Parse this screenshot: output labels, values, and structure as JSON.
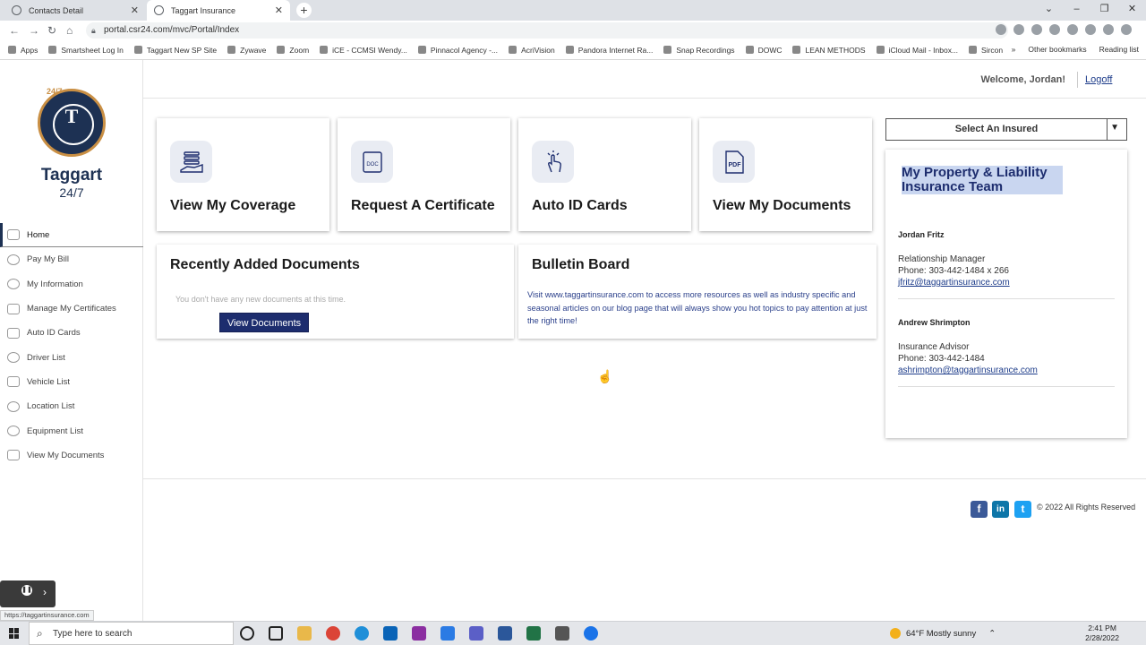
{
  "browser": {
    "tabs": [
      {
        "label": "Contacts Detail",
        "active": false
      },
      {
        "label": "Taggart Insurance",
        "active": true
      }
    ],
    "new_tab": "+",
    "url": "portal.csr24.com/mvc/Portal/Index",
    "bookmarks": [
      "Apps",
      "Smartsheet Log In",
      "Taggart New SP Site",
      "Zywave",
      "Zoom",
      "iCE - CCMSI Wendy...",
      "Pinnacol Agency -...",
      "AcriVision",
      "Pandora Internet Ra...",
      "Snap Recordings",
      "DOWC",
      "LEAN METHODS",
      "iCloud Mail - Inbox...",
      "Sircon"
    ],
    "bookmarks_overflow": "»",
    "other_bookmarks": "Other bookmarks",
    "reading_list": "Reading list"
  },
  "logo": {
    "hours": "24/7",
    "name": "Taggart",
    "tagline": "24/7",
    "mark": "T"
  },
  "sidebar": {
    "items": [
      {
        "label": "Home",
        "active": true
      },
      {
        "label": "Pay My Bill"
      },
      {
        "label": "My Information"
      },
      {
        "label": "Manage My Certificates"
      },
      {
        "label": "Auto ID Cards"
      },
      {
        "label": "Driver List"
      },
      {
        "label": "Vehicle List"
      },
      {
        "label": "Location List"
      },
      {
        "label": "Equipment List"
      },
      {
        "label": "View My Documents"
      }
    ]
  },
  "header": {
    "welcome": "Welcome, Jordan!",
    "logoff": "Logoff"
  },
  "cards": [
    {
      "label": "View My Coverage",
      "icon": "coverage-icon"
    },
    {
      "label": "Request A Certificate",
      "icon": "certificate-icon"
    },
    {
      "label": "Auto ID Cards",
      "icon": "touch-icon"
    },
    {
      "label": "View My Documents",
      "icon": "pdf-icon"
    }
  ],
  "recent_docs": {
    "title": "Recently Added Documents",
    "empty_text": "You don't have any new documents at this time.",
    "button": "View Documents"
  },
  "bulletin": {
    "title": "Bulletin Board",
    "text": "Visit www.taggartinsurance.com to access more resources as well as industry specific and seasonal articles on our blog page that will always show you hot topics to pay attention at just the right time!"
  },
  "insured_select": {
    "label": "Select An Insured"
  },
  "team": {
    "title": "My Property & Liability Insurance Team",
    "contacts": [
      {
        "name": "Jordan Fritz",
        "role": "Relationship Manager",
        "phone": "Phone: 303-442-1484 x 266",
        "email": "jfritz@taggartinsurance.com"
      },
      {
        "name": "Andrew Shrimpton",
        "role": "Insurance Advisor",
        "phone": "Phone: 303-442-1484",
        "email": "ashrimpton@taggartinsurance.com"
      }
    ]
  },
  "footer": {
    "copyright": "© 2022 All Rights Reserved",
    "social": [
      "f",
      "in",
      "t"
    ]
  },
  "status_url": "https://taggartinsurance.com",
  "taskbar": {
    "search_placeholder": "Type here to search",
    "weather": "64°F  Mostly sunny",
    "time": "2:41 PM",
    "date": "2/28/2022"
  },
  "colors": {
    "brand_navy": "#1d2d6e",
    "brand_gold": "#c98f44",
    "link_blue": "#1d3c8a"
  }
}
